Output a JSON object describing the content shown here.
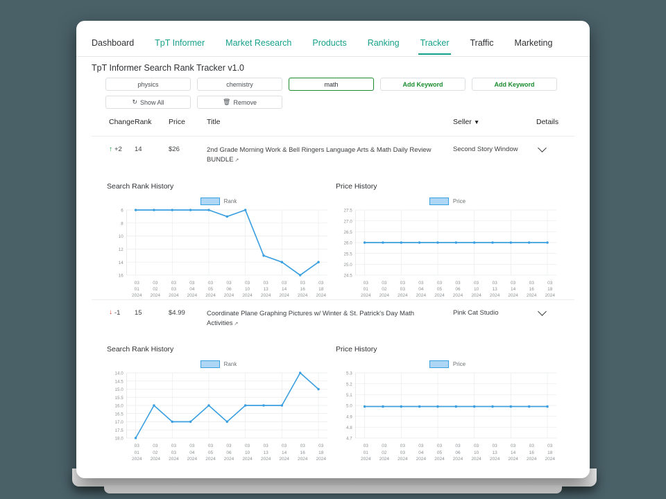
{
  "nav": {
    "tabs": [
      {
        "label": "Dashboard",
        "style": "dark",
        "active": false
      },
      {
        "label": "TpT Informer",
        "style": "teal",
        "active": false
      },
      {
        "label": "Market Research",
        "style": "teal",
        "active": false
      },
      {
        "label": "Products",
        "style": "teal",
        "active": false
      },
      {
        "label": "Ranking",
        "style": "teal",
        "active": false
      },
      {
        "label": "Tracker",
        "style": "teal",
        "active": true
      },
      {
        "label": "Traffic",
        "style": "dark",
        "active": false
      },
      {
        "label": "Marketing",
        "style": "dark",
        "active": false
      }
    ]
  },
  "page": {
    "title": "TpT Informer Search Rank Tracker v1.0"
  },
  "keywords": {
    "buttons": [
      {
        "label": "physics",
        "selected": false,
        "add": false
      },
      {
        "label": "chemistry",
        "selected": false,
        "add": false
      },
      {
        "label": "math",
        "selected": true,
        "add": false
      },
      {
        "label": "Add Keyword",
        "selected": false,
        "add": true
      },
      {
        "label": "Add Keyword",
        "selected": false,
        "add": true
      }
    ],
    "actions": [
      {
        "label": "Show All",
        "icon": "refresh-icon",
        "glyph": "↻"
      },
      {
        "label": "Remove",
        "icon": "trash-icon",
        "glyph": "🗑"
      }
    ]
  },
  "table": {
    "headers": {
      "change": "Change",
      "rank": "Rank",
      "price": "Price",
      "title": "Title",
      "seller": "Seller",
      "seller_filter_icon": "filter-icon",
      "details": "Details"
    },
    "rows": [
      {
        "change": "+2",
        "change_dir": "up",
        "rank": "14",
        "price": "$26",
        "title": "2nd Grade Morning Work & Bell Ringers Language Arts & Math Daily Review BUNDLE",
        "seller": "Second Story Window"
      },
      {
        "change": "-1",
        "change_dir": "down",
        "rank": "15",
        "price": "$4.99",
        "title": "Coordinate Plane Graphing Pictures w/ Winter & St. Patrick's Day Math Activities",
        "seller": "Pink Cat Studio"
      }
    ]
  },
  "colors": {
    "line": "#3a9fe0",
    "legend_fill": "#aed6f5",
    "accent_teal": "#15a08a",
    "accent_green": "#1a8c2e",
    "up_green": "#14a33b",
    "down_red": "#e0392f"
  },
  "chart_data": [
    {
      "type": "line",
      "title": "Search Rank History",
      "legend": [
        "Rank"
      ],
      "legend_position": "top-center",
      "xlabel": "",
      "ylabel": "",
      "grid": true,
      "y_inverted": true,
      "yticks": [
        6,
        8,
        10,
        12,
        14,
        16
      ],
      "ylim": [
        6,
        16
      ],
      "categories": [
        "03 01 2024",
        "03 02 2024",
        "03 03 2024",
        "03 04 2024",
        "03 05 2024",
        "03 06 2024",
        "03 10 2024",
        "03 13 2024",
        "03 14 2024",
        "03 16 2024",
        "03 18 2024"
      ],
      "xtick_lines": [
        [
          "03",
          "01",
          "2024"
        ],
        [
          "03",
          "02",
          "2024"
        ],
        [
          "03",
          "03",
          "2024"
        ],
        [
          "03",
          "04",
          "2024"
        ],
        [
          "03",
          "05",
          "2024"
        ],
        [
          "03",
          "06",
          "2024"
        ],
        [
          "03",
          "10",
          "2024"
        ],
        [
          "03",
          "13",
          "2024"
        ],
        [
          "03",
          "14",
          "2024"
        ],
        [
          "03",
          "16",
          "2024"
        ],
        [
          "03",
          "18",
          "2024"
        ]
      ],
      "values": [
        6,
        6,
        6,
        6,
        6,
        7,
        6,
        13,
        14,
        16,
        14
      ]
    },
    {
      "type": "line",
      "title": "Price History",
      "legend": [
        "Price"
      ],
      "legend_position": "top-center",
      "xlabel": "",
      "ylabel": "",
      "grid": true,
      "y_inverted": false,
      "yticks": [
        27.5,
        27.0,
        26.5,
        26.0,
        25.5,
        25.0,
        24.5
      ],
      "ylim": [
        24.5,
        27.5
      ],
      "categories": [
        "03 01 2024",
        "03 02 2024",
        "03 03 2024",
        "03 04 2024",
        "03 05 2024",
        "03 06 2024",
        "03 10 2024",
        "03 13 2024",
        "03 14 2024",
        "03 16 2024",
        "03 18 2024"
      ],
      "xtick_lines": [
        [
          "03",
          "01",
          "2024"
        ],
        [
          "03",
          "02",
          "2024"
        ],
        [
          "03",
          "03",
          "2024"
        ],
        [
          "03",
          "04",
          "2024"
        ],
        [
          "03",
          "05",
          "2024"
        ],
        [
          "03",
          "06",
          "2024"
        ],
        [
          "03",
          "10",
          "2024"
        ],
        [
          "03",
          "13",
          "2024"
        ],
        [
          "03",
          "14",
          "2024"
        ],
        [
          "03",
          "16",
          "2024"
        ],
        [
          "03",
          "18",
          "2024"
        ]
      ],
      "values": [
        26.0,
        26.0,
        26.0,
        26.0,
        26.0,
        26.0,
        26.0,
        26.0,
        26.0,
        26.0,
        26.0
      ]
    },
    {
      "type": "line",
      "title": "Search Rank History",
      "legend": [
        "Rank"
      ],
      "legend_position": "top-center",
      "xlabel": "",
      "ylabel": "",
      "grid": true,
      "y_inverted": true,
      "yticks": [
        14.0,
        14.5,
        15.0,
        15.5,
        16.0,
        16.5,
        17.0,
        17.5,
        18.0
      ],
      "ylim": [
        14,
        18
      ],
      "categories": [
        "03 01 2024",
        "03 02 2024",
        "03 03 2024",
        "03 04 2024",
        "03 05 2024",
        "03 06 2024",
        "03 10 2024",
        "03 13 2024",
        "03 14 2024",
        "03 16 2024",
        "03 18 2024"
      ],
      "xtick_lines": [
        [
          "03",
          "01",
          "2024"
        ],
        [
          "03",
          "02",
          "2024"
        ],
        [
          "03",
          "03",
          "2024"
        ],
        [
          "03",
          "04",
          "2024"
        ],
        [
          "03",
          "05",
          "2024"
        ],
        [
          "03",
          "06",
          "2024"
        ],
        [
          "03",
          "10",
          "2024"
        ],
        [
          "03",
          "13",
          "2024"
        ],
        [
          "03",
          "14",
          "2024"
        ],
        [
          "03",
          "16",
          "2024"
        ],
        [
          "03",
          "18",
          "2024"
        ]
      ],
      "values": [
        18,
        16,
        17,
        17,
        16,
        17,
        16,
        16,
        16,
        14,
        15
      ]
    },
    {
      "type": "line",
      "title": "Price History",
      "legend": [
        "Price"
      ],
      "legend_position": "top-center",
      "xlabel": "",
      "ylabel": "",
      "grid": true,
      "y_inverted": false,
      "yticks": [
        5.3,
        5.2,
        5.1,
        5.0,
        4.9,
        4.8,
        4.7
      ],
      "ylim": [
        4.7,
        5.3
      ],
      "categories": [
        "03 01 2024",
        "03 02 2024",
        "03 03 2024",
        "03 04 2024",
        "03 05 2024",
        "03 06 2024",
        "03 10 2024",
        "03 13 2024",
        "03 14 2024",
        "03 16 2024",
        "03 18 2024"
      ],
      "xtick_lines": [
        [
          "03",
          "01",
          "2024"
        ],
        [
          "03",
          "02",
          "2024"
        ],
        [
          "03",
          "03",
          "2024"
        ],
        [
          "03",
          "04",
          "2024"
        ],
        [
          "03",
          "05",
          "2024"
        ],
        [
          "03",
          "06",
          "2024"
        ],
        [
          "03",
          "10",
          "2024"
        ],
        [
          "03",
          "13",
          "2024"
        ],
        [
          "03",
          "14",
          "2024"
        ],
        [
          "03",
          "16",
          "2024"
        ],
        [
          "03",
          "18",
          "2024"
        ]
      ],
      "values": [
        4.99,
        4.99,
        4.99,
        4.99,
        4.99,
        4.99,
        4.99,
        4.99,
        4.99,
        4.99,
        4.99
      ]
    }
  ]
}
